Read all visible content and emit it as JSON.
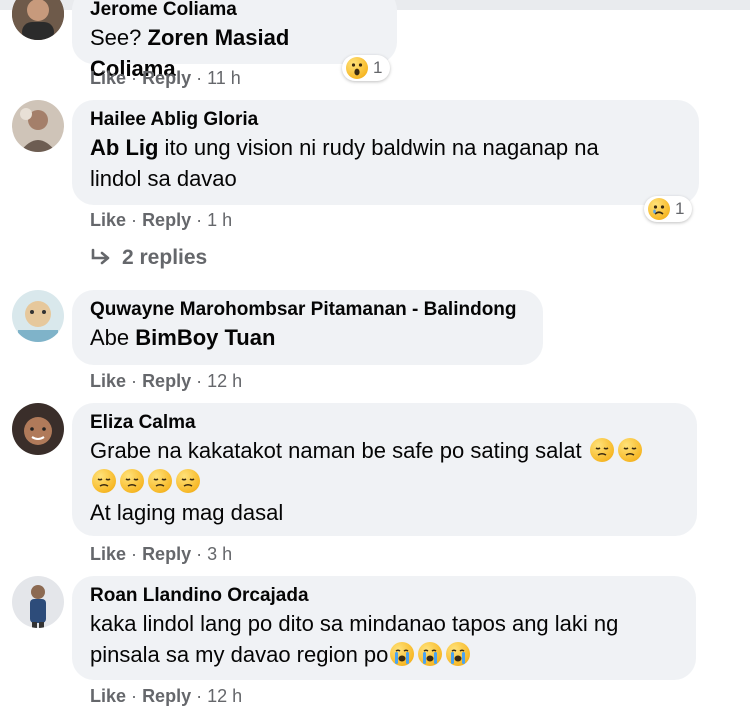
{
  "comments": [
    {
      "author": "Jerome Coliama",
      "text_prefix": "See? ",
      "mention": "Zoren Masiad Coliama",
      "like": "Like",
      "reply": "Reply",
      "sep": "·",
      "time": "11 h",
      "reaction": {
        "emoji": "wow-emoji-icon",
        "count": "1"
      }
    },
    {
      "author": "Hailee Ablig Gloria",
      "mention": "Ab Lig",
      "text_line1": " ito ung vision ni rudy baldwin na naganap na",
      "text_line2": "lindol sa davao",
      "like": "Like",
      "reply": "Reply",
      "sep": "·",
      "time": "1 h",
      "reaction": {
        "emoji": "sad-emoji-icon",
        "count": "1"
      },
      "replies_label": "2 replies"
    },
    {
      "author": "Quwayne Marohombsar Pitamanan - Balindong",
      "text_prefix": "Abe ",
      "mention": "BimBoy Tuan",
      "like": "Like",
      "reply": "Reply",
      "sep": "·",
      "time": "12 h"
    },
    {
      "author": "Eliza Calma",
      "text_line1": "Grabe na kakatakot naman be safe po sating salat ",
      "text_line3": "At laging mag dasal",
      "emoji": "pensive-emoji-icon",
      "like": "Like",
      "reply": "Reply",
      "sep": "·",
      "time": "3 h"
    },
    {
      "author": "Roan Llandino Orcajada",
      "text_line1": "kaka lindol lang po dito sa mindanao tapos ang laki ng",
      "text_line2": "pinsala sa my davao region po",
      "emoji": "crying-emoji-icon",
      "like": "Like",
      "reply": "Reply",
      "sep": "·",
      "time": "12 h"
    }
  ],
  "colors": {
    "bubble": "#f0f2f5",
    "meta": "#65676b",
    "text": "#050505"
  }
}
